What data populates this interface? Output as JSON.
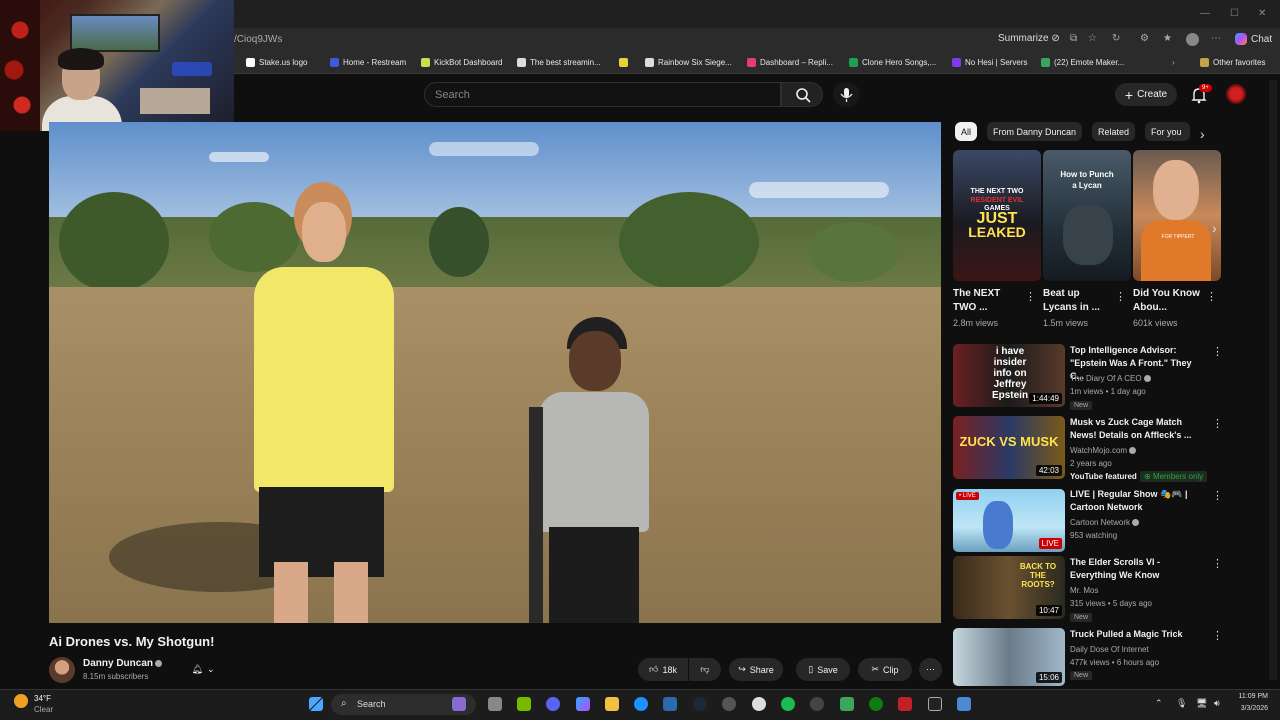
{
  "browser": {
    "url": "/Cioq9JWs",
    "summarize_label": "Summarize",
    "chat_label": "Chat",
    "other_favorites": "Other favorites",
    "bookmarks": [
      {
        "label": "Stake.us logo",
        "color": "#ffffff"
      },
      {
        "label": "Home - Restream",
        "color": "#3b5bdb"
      },
      {
        "label": "KickBot Dashboard",
        "color": "#c8e04a"
      },
      {
        "label": "The best streamin...",
        "color": "#dddddd"
      },
      {
        "label": "",
        "color": "#e6d23a"
      },
      {
        "label": "Rainbow Six Siege...",
        "color": "#dddddd"
      },
      {
        "label": "Dashboard – Repli...",
        "color": "#e0406a"
      },
      {
        "label": "Clone Hero Songs,...",
        "color": "#1f9d55"
      },
      {
        "label": "No Hesi | Servers",
        "color": "#7c3aed"
      },
      {
        "label": "(22) Emote Maker...",
        "color": "#3aa55d"
      }
    ]
  },
  "youtube": {
    "search_placeholder": "Search",
    "create_label": "Create",
    "notif_badge": "9+",
    "video": {
      "title": "Ai Drones vs. My Shotgun!",
      "channel": "Danny Duncan",
      "subscribers": "8.15m subscribers",
      "likes": "18k",
      "share_label": "Share",
      "save_label": "Save",
      "clip_label": "Clip"
    },
    "chips": [
      "All",
      "From Danny Duncan",
      "Related",
      "For you"
    ],
    "shorts": [
      {
        "title": "The NEXT TWO ...",
        "views": "2.8m views",
        "overlay": [
          "THE NEXT TWO",
          "RESIDENT EVIL",
          "GAMES",
          "JUST",
          "LEAKED"
        ]
      },
      {
        "title": "Beat up Lycans in ...",
        "views": "1.5m views",
        "overlay": [
          "How to Punch",
          "a Lycan"
        ]
      },
      {
        "title": "Did You Know Abou...",
        "views": "601k views",
        "overlay": [
          "FOR TIPPERT"
        ]
      }
    ],
    "recommendations": [
      {
        "title": "Top Intelligence Advisor: \"Epstein Was A Front.\" They C...",
        "channel": "The Diary Of A CEO",
        "meta": "1m views • 1 day ago",
        "badge": "New",
        "duration": "1:44:49",
        "thumb_text": "i have insider info on Jeffrey Epstein"
      },
      {
        "title": "Musk vs Zuck Cage Match News! Details on Affleck's ...",
        "channel": "WatchMojo.com",
        "meta": "2 years ago",
        "badge": "YouTube featured",
        "members": "Members only",
        "duration": "42:03",
        "thumb_text": "ZUCK VS MUSK"
      },
      {
        "title": "LIVE | Regular Show 🎭🎮 | Cartoon Network",
        "channel": "Cartoon Network",
        "meta": "953 watching",
        "badge": "",
        "duration": "LIVE",
        "thumb_text": "LIVE"
      },
      {
        "title": "The Elder Scrolls VI - Everything We Know",
        "channel": "Mr. Mos",
        "meta": "315 views • 5 days ago",
        "badge": "New",
        "duration": "10:47",
        "thumb_text": "BACK TO THE ROOTS?"
      },
      {
        "title": "Truck Pulled a Magic Trick",
        "channel": "Daily Dose Of Internet",
        "meta": "477k views • 6 hours ago",
        "badge": "New",
        "duration": "15:06",
        "thumb_text": ""
      }
    ]
  },
  "taskbar": {
    "weather_temp": "34°F",
    "weather_cond": "Clear",
    "search_label": "Search",
    "time": "11:09 PM",
    "date": "3/3/2026"
  }
}
